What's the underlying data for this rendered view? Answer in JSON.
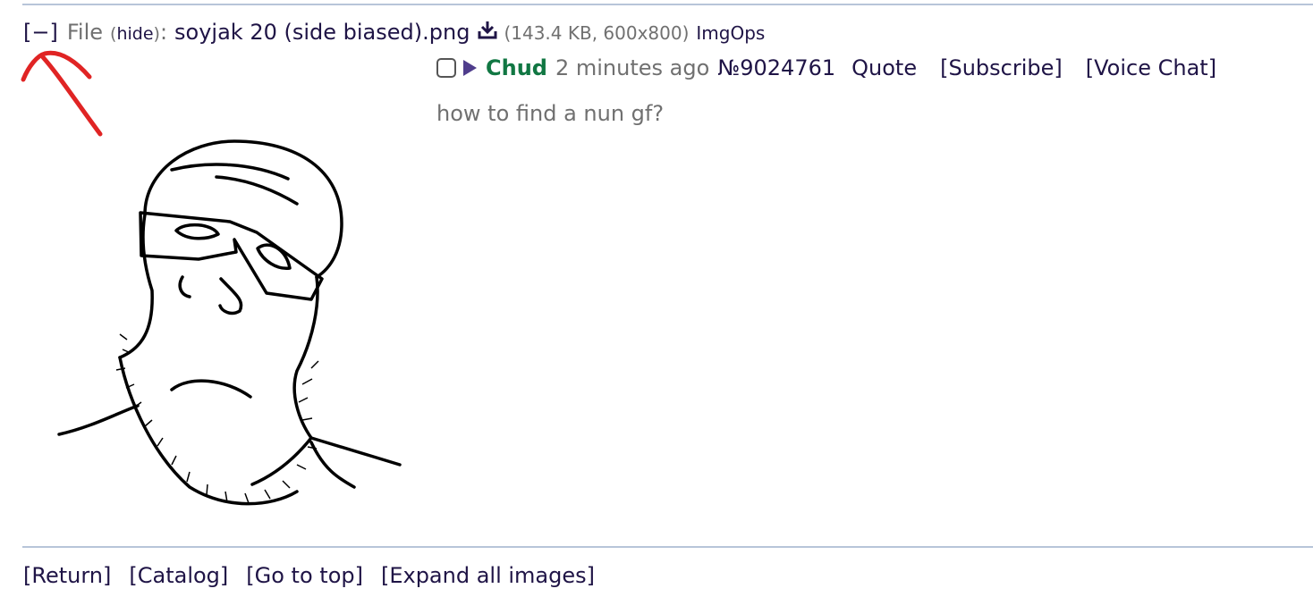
{
  "file": {
    "collapse_label": "[−]",
    "file_label": "File",
    "hide_open": "(",
    "hide_label": "hide",
    "hide_close": ")",
    "colon": ":",
    "filename": "soyjak 20 (side biased).png",
    "download_icon": "download-icon",
    "meta": "(143.4 KB, 600x800)",
    "imgops_label": "ImgOps"
  },
  "annotation": {
    "arrow_color": "#e02424"
  },
  "post": {
    "name": "Chud",
    "time": "2 minutes ago",
    "number": "№9024761",
    "quote_label": "Quote",
    "subscribe_label": "[Subscribe]",
    "voice_chat_label": "[Voice Chat]",
    "body": "how to find a nun gf?"
  },
  "nav": {
    "return_label": "[Return]",
    "catalog_label": "[Catalog]",
    "top_label": "[Go to top]",
    "expand_label": "[Expand all images]"
  },
  "colors": {
    "link": "#1f1446",
    "name": "#117743",
    "muted": "#707070",
    "rule": "#b7c5d9"
  }
}
